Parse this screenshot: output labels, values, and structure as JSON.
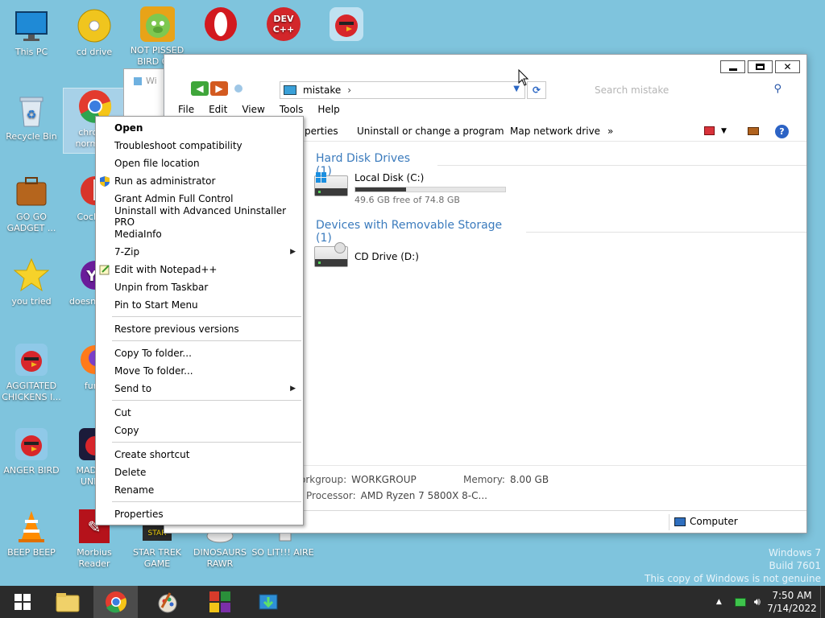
{
  "desktop": {
    "icons": [
      {
        "label": "This PC"
      },
      {
        "label": "cd drive"
      },
      {
        "label": "NOT PISSED BIRD G..."
      },
      {
        "label": "Recycle Bin"
      },
      {
        "label": "chrome normal..."
      },
      {
        "label": "GO GO GADGET ..."
      },
      {
        "label": "CockC..."
      },
      {
        "label": "you tried"
      },
      {
        "label": "doesn't lo..."
      },
      {
        "label": "AGGITATED CHICKENS I..."
      },
      {
        "label": "furry"
      },
      {
        "label": "ANGER BIRD"
      },
      {
        "label": "MAD B... UNIV..."
      },
      {
        "label": "BEEP BEEP"
      },
      {
        "label": "Morbius Reader"
      },
      {
        "label": "STAR TREK GAME"
      },
      {
        "label": "DINOSAURS RAWR"
      },
      {
        "label": "SO LIT!!! AIRE"
      }
    ]
  },
  "behind_window": {
    "title": "Wi"
  },
  "explorer": {
    "address": {
      "path": "mistake"
    },
    "search": {
      "placeholder": "Search mistake"
    },
    "menu": [
      "File",
      "Edit",
      "View",
      "Tools",
      "Help"
    ],
    "toolbar": {
      "properties": "perties",
      "uninstall": "Uninstall or change a program",
      "map_drive": "Map network drive",
      "more": "»"
    },
    "groups": {
      "hdd": "Hard Disk Drives (1)",
      "removable": "Devices with Removable Storage (1)"
    },
    "drives": {
      "c": {
        "name": "Local Disk (C:)",
        "free": "49.6 GB free of 74.8 GB",
        "used_fraction": 0.337
      },
      "d": {
        "name": "CD Drive (D:)"
      }
    },
    "details": {
      "workgroup_label": "orkgroup:",
      "workgroup_value": "WORKGROUP",
      "memory_label": "Memory:",
      "memory_value": "8.00 GB",
      "processor_label": "Processor:",
      "processor_value": "AMD Ryzen 7 5800X 8-C..."
    },
    "status": {
      "location": "Computer"
    }
  },
  "context_menu": {
    "items": {
      "open": "Open",
      "troubleshoot": "Troubleshoot compatibility",
      "open_location": "Open file location",
      "run_admin": "Run as administrator",
      "grant_admin": "Grant Admin Full Control",
      "uninstall_adv": "Uninstall with Advanced Uninstaller PRO",
      "mediainfo": "MediaInfo",
      "sevenzip": "7-Zip",
      "notepadpp": "Edit with Notepad++",
      "unpin": "Unpin from Taskbar",
      "pin_start": "Pin to Start Menu",
      "restore": "Restore previous versions",
      "copy_to": "Copy To folder...",
      "move_to": "Move To folder...",
      "send_to": "Send to",
      "cut": "Cut",
      "copy": "Copy",
      "create_shortcut": "Create shortcut",
      "delete": "Delete",
      "rename": "Rename",
      "properties": "Properties"
    }
  },
  "watermark": {
    "line1": "Windows 7",
    "line2": "Build 7601",
    "line3": "This copy of Windows is not genuine"
  },
  "taskbar": {
    "clock_time": "7:50 AM",
    "clock_date": "7/14/2022"
  },
  "icons": {
    "close": "close-icon",
    "maximize": "maximize-icon",
    "minimize": "minimize-icon"
  }
}
